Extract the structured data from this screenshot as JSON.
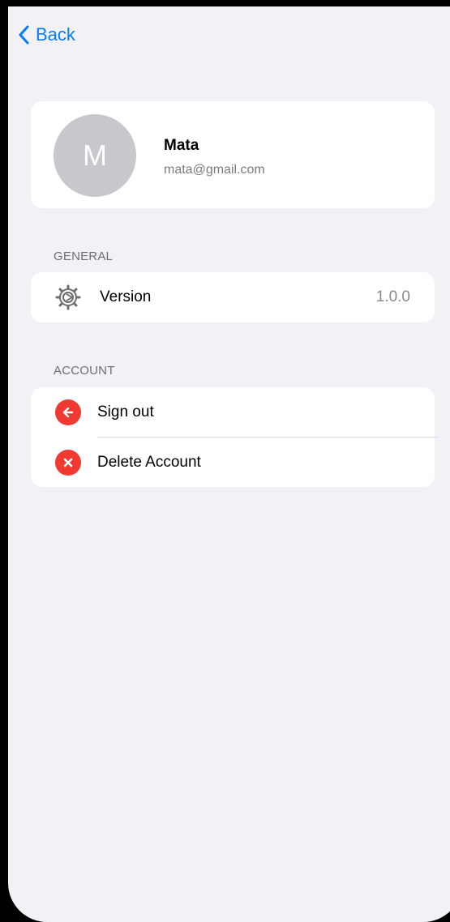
{
  "nav": {
    "back_label": "Back"
  },
  "profile": {
    "initial": "M",
    "name": "Mata",
    "email": "mata@gmail.com"
  },
  "general": {
    "header": "GENERAL",
    "version_label": "Version",
    "version_value": "1.0.0",
    "icon": "gear-icon"
  },
  "account": {
    "header": "ACCOUNT",
    "sign_out_label": "Sign out",
    "delete_label": "Delete Account",
    "sign_out_icon": "arrow-left-icon",
    "delete_icon": "close-icon"
  },
  "colors": {
    "accent": "#0a7aff",
    "destructive": "#f03a31",
    "background": "#f1f1f6"
  }
}
